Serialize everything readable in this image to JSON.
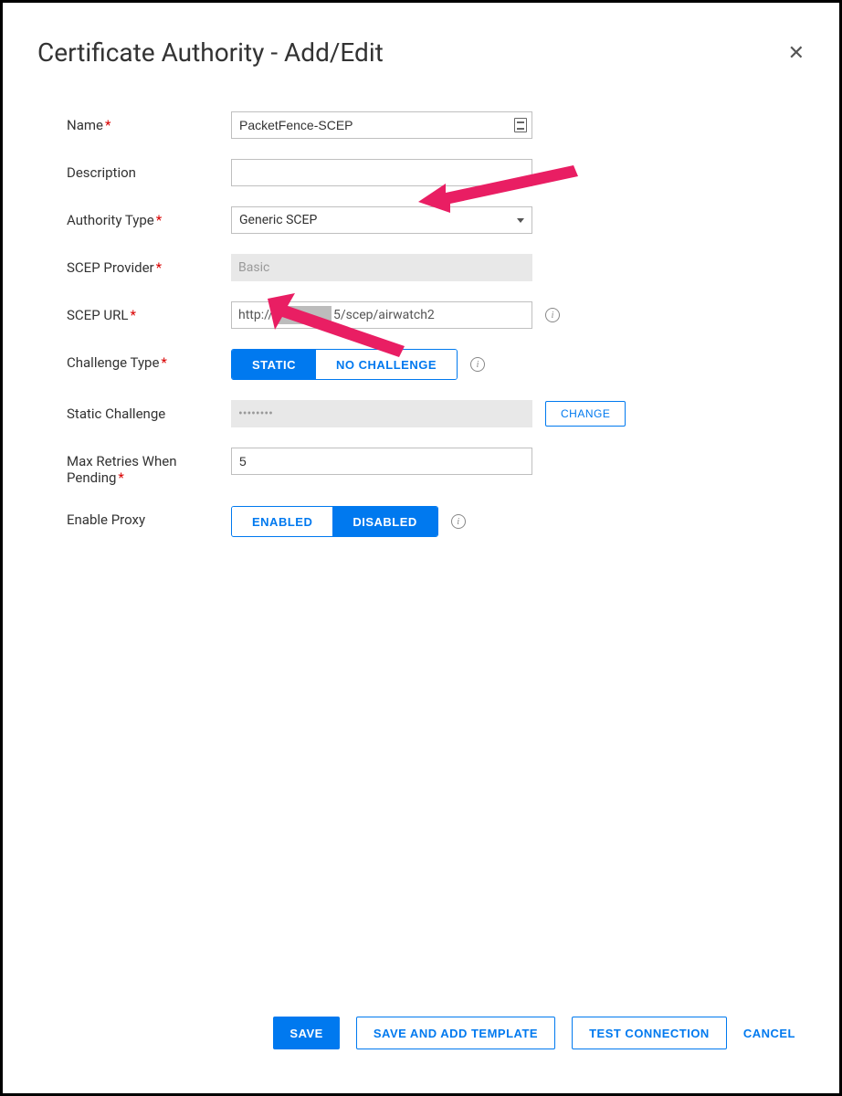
{
  "header": {
    "title": "Certificate Authority - Add/Edit"
  },
  "fields": {
    "name": {
      "label": "Name",
      "value": "PacketFence-SCEP"
    },
    "description": {
      "label": "Description",
      "value": ""
    },
    "authority_type": {
      "label": "Authority Type",
      "value": "Generic SCEP"
    },
    "scep_provider": {
      "label": "SCEP Provider",
      "value": "Basic"
    },
    "scep_url": {
      "label": "SCEP URL",
      "prefix": "http://",
      "redacted_segment": "5",
      "suffix": "/scep/airwatch2"
    },
    "challenge_type": {
      "label": "Challenge Type",
      "options": {
        "static": "STATIC",
        "none": "NO CHALLENGE"
      },
      "selected": "static"
    },
    "static_challenge": {
      "label": "Static Challenge",
      "mask": "••••••••",
      "change": "CHANGE"
    },
    "max_retries": {
      "label": "Max Retries When Pending",
      "value": "5"
    },
    "enable_proxy": {
      "label": "Enable Proxy",
      "options": {
        "enabled": "ENABLED",
        "disabled": "DISABLED"
      },
      "selected": "disabled"
    }
  },
  "footer": {
    "save": "SAVE",
    "save_add": "SAVE AND ADD TEMPLATE",
    "test": "TEST CONNECTION",
    "cancel": "CANCEL"
  },
  "colors": {
    "primary": "#0079ef",
    "required": "#d90000",
    "annotation": "#e91e63"
  }
}
